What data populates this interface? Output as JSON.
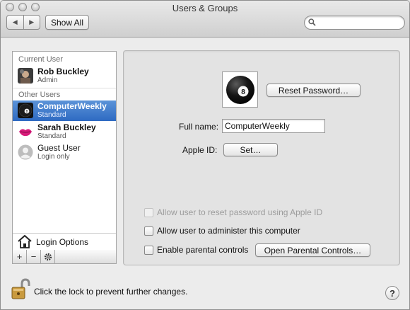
{
  "window": {
    "title": "Users & Groups",
    "toolbar": {
      "back_icon": "back-arrow-icon",
      "forward_icon": "forward-arrow-icon",
      "show_all_label": "Show All",
      "search_placeholder": "",
      "search_value": ""
    }
  },
  "sidebar": {
    "current_user_heading": "Current User",
    "other_users_heading": "Other Users",
    "users": [
      {
        "name": "Rob Buckley",
        "role": "Admin",
        "selected": false
      },
      {
        "name": "ComputerWeekly",
        "role": "Standard",
        "selected": true
      },
      {
        "name": "Sarah Buckley",
        "role": "Standard",
        "selected": false
      },
      {
        "name": "Guest User",
        "role": "Login only",
        "selected": false
      }
    ],
    "login_options_label": "Login Options",
    "add_label": "+",
    "remove_label": "−",
    "gear_icon": "gear-icon"
  },
  "details": {
    "reset_password_label": "Reset Password…",
    "full_name_label": "Full name:",
    "full_name_value": "ComputerWeekly",
    "apple_id_label": "Apple ID:",
    "set_label": "Set…",
    "checkboxes": [
      {
        "label": "Allow user to reset password using Apple ID",
        "checked": false,
        "enabled": false
      },
      {
        "label": "Allow user to administer this computer",
        "checked": false,
        "enabled": true
      },
      {
        "label": "Enable parental controls",
        "checked": false,
        "enabled": true
      }
    ],
    "open_parental_controls_label": "Open Parental Controls…"
  },
  "footer": {
    "lock_text": "Click the lock to prevent further changes.",
    "help_label": "?"
  },
  "colors": {
    "selection": "#2e6ac2",
    "window_bg": "#ececec",
    "panel_bg": "#e3e3e3"
  }
}
